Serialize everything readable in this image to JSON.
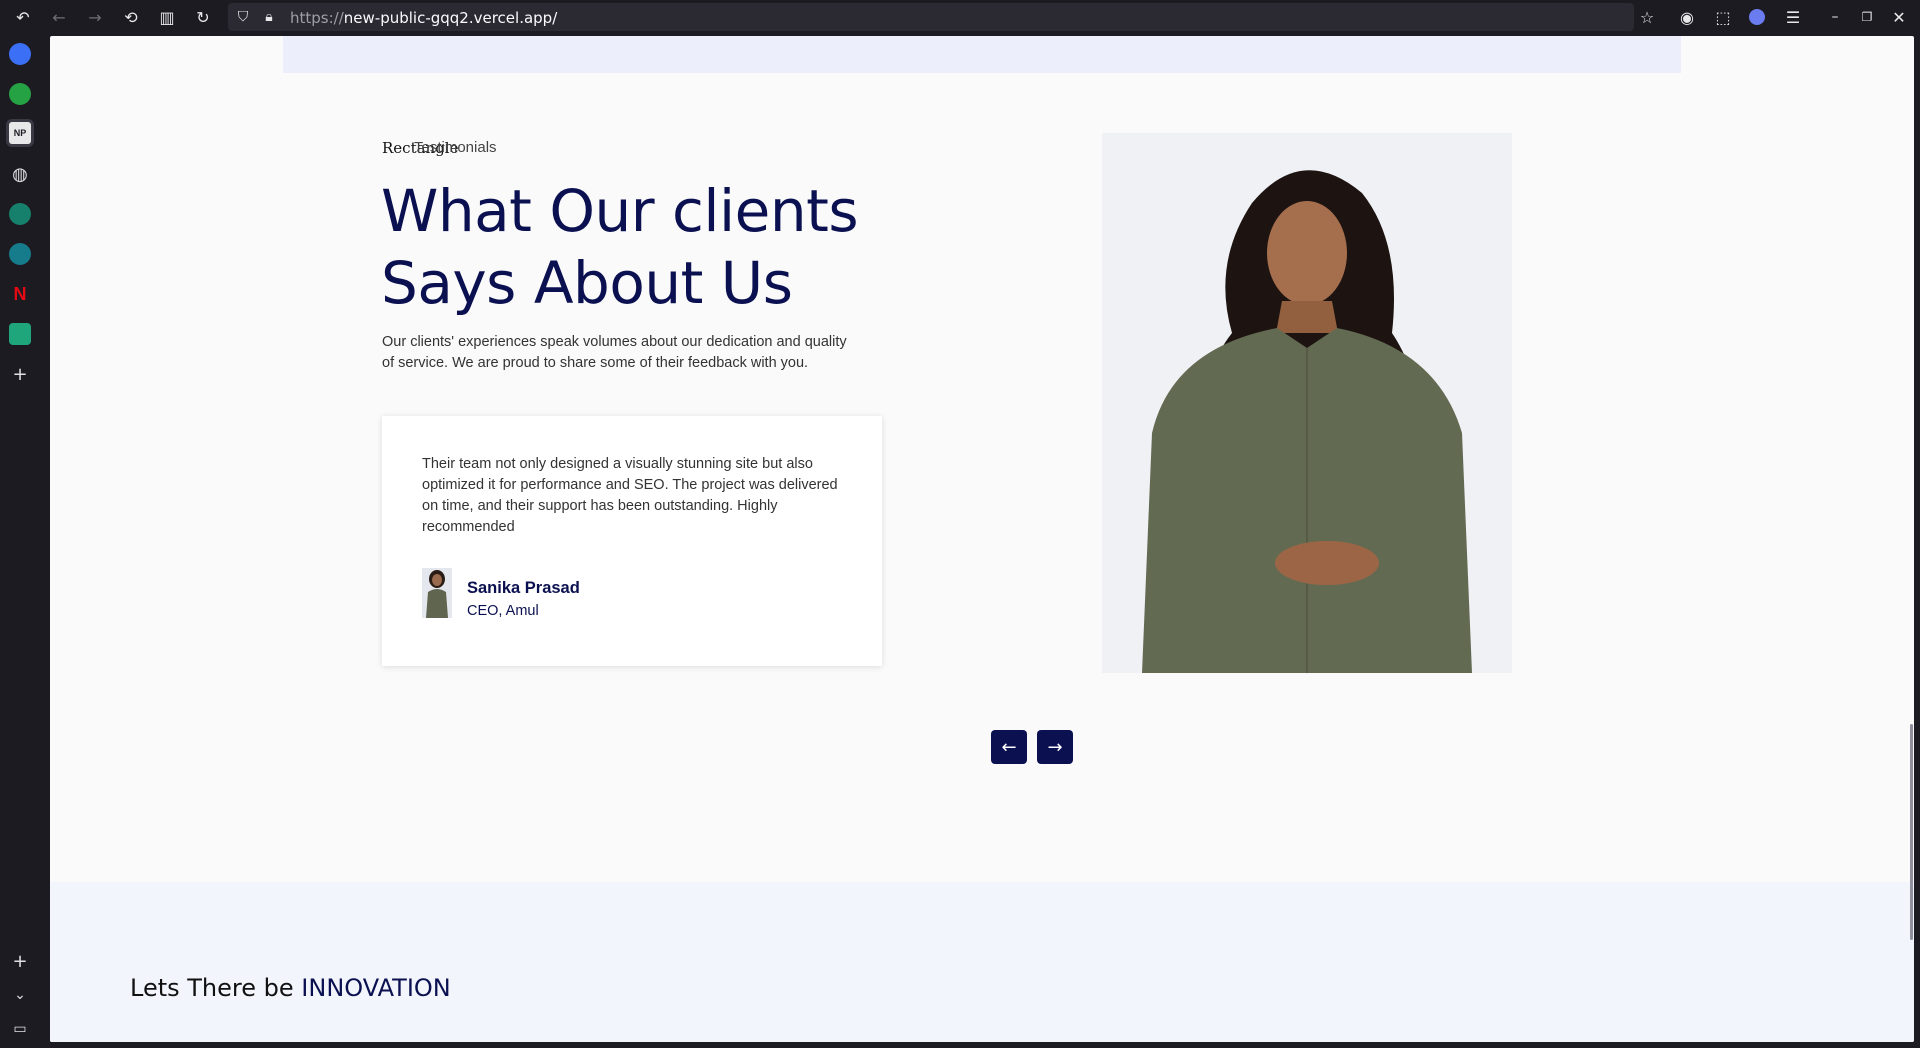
{
  "browser": {
    "url_prefix": "https://",
    "url_host": "new-public-gqq2.vercel.app/"
  },
  "page": {
    "decor_label": "Rectangle",
    "section_tag": "Testimonials",
    "heading_line1": "What Our clients",
    "heading_line2": "Says About Us",
    "lead": "Our clients' experiences speak volumes about our dedication and quality of service. We are proud to share some of their feedback with you.",
    "testimonial": {
      "quote": "Their team not only designed a visually stunning site but also optimized it for performance and SEO. The project was delivered on time, and their support has been outstanding. Highly recommended",
      "name": "Sanika Prasad",
      "role": "CEO, Amul"
    },
    "tagline_plain": "Lets There be",
    "tagline_accent": "INNOVATION"
  },
  "colors": {
    "brand_navy": "#0b1150",
    "page_bg": "#fafafb",
    "band_bg": "#eceefb"
  }
}
